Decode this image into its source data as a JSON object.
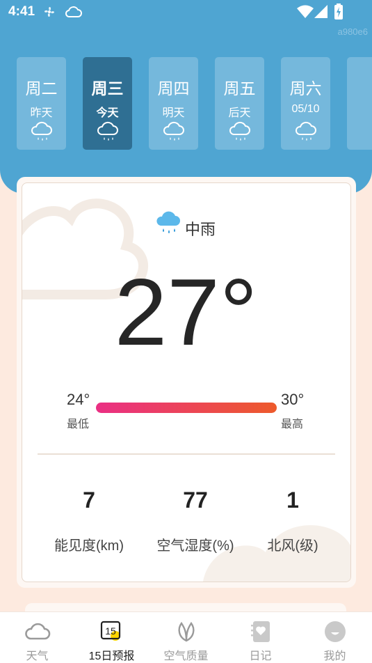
{
  "status": {
    "time": "4:41"
  },
  "watermark": "a980e6",
  "days": [
    {
      "name": "周二",
      "sub": "昨天",
      "icon": "rain-cloud-icon"
    },
    {
      "name": "周三",
      "sub": "今天",
      "icon": "rain-cloud-icon",
      "selected": true
    },
    {
      "name": "周四",
      "sub": "明天",
      "icon": "rain-cloud-icon"
    },
    {
      "name": "周五",
      "sub": "后天",
      "icon": "rain-cloud-icon"
    },
    {
      "name": "周六",
      "sub": "05/10",
      "icon": "rain-cloud-icon"
    }
  ],
  "weather": {
    "condition": "中雨",
    "temperature": "27°",
    "low": {
      "value": "24°",
      "label": "最低"
    },
    "high": {
      "value": "30°",
      "label": "最高"
    }
  },
  "stats": [
    {
      "value": "7",
      "label": "能见度(km)"
    },
    {
      "value": "77",
      "label": "空气湿度(%)"
    },
    {
      "value": "1",
      "label": "北风(级)"
    }
  ],
  "nav": [
    {
      "label": "天气",
      "icon": "cloud-icon"
    },
    {
      "label": "15日预报",
      "icon": "calendar-15-icon",
      "badge": "15",
      "active": true
    },
    {
      "label": "空气质量",
      "icon": "leaf-icon"
    },
    {
      "label": "日记",
      "icon": "diary-icon"
    },
    {
      "label": "我的",
      "icon": "profile-icon"
    }
  ],
  "colors": {
    "header": "#4fa5d2",
    "selected_day": "#2f6f93",
    "background": "#fdeadf",
    "bar_start": "#ea2f84",
    "bar_end": "#ed5a2b"
  }
}
